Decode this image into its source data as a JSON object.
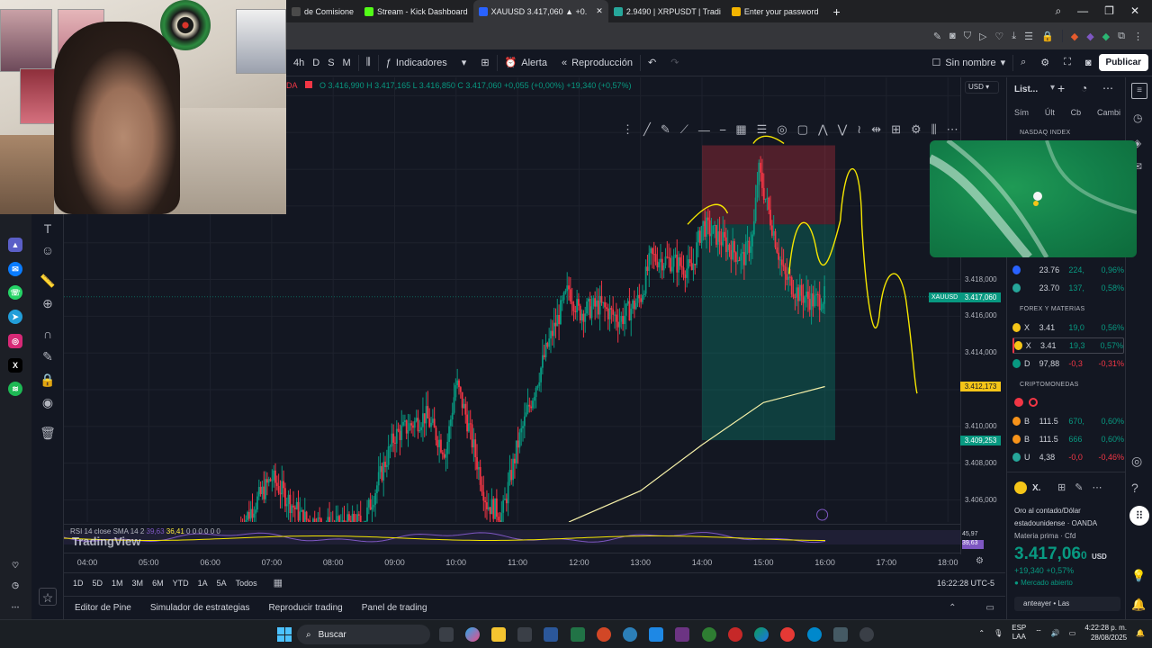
{
  "browser": {
    "tabs": [
      {
        "label": "de Comisione",
        "icon_color": "#4a4a4a"
      },
      {
        "label": "Stream - Kick Dashboard",
        "icon_color": "#53fc18"
      },
      {
        "label": "XAUUSD 3.417,060 ▲ +0.",
        "icon_color": "#2962ff",
        "active": true
      },
      {
        "label": "2.9490 | XRPUSDT | Tradi",
        "icon_color": "#26a69a"
      },
      {
        "label": "Enter your password",
        "icon_color": "#f4b400"
      }
    ],
    "new_tab_icon": "plus-icon"
  },
  "toolbar": {
    "timeframes": [
      "4h",
      "D",
      "S",
      "M"
    ],
    "indicators_label": "Indicadores",
    "alert_label": "Alerta",
    "replay_label": "Reproducción",
    "layout_name": "Sin nombre",
    "publish_label": "Publicar"
  },
  "ohlc": {
    "symbol_fragment": "DA",
    "text": "O 3.416,990 H 3.417,165 L 3.416,850 C 3.417,060 +0,055 (+0,00%) +19,340 (+0,57%)"
  },
  "price_axis": {
    "currency": "USD",
    "labels": [
      {
        "value": "3.418,000",
        "price": 3418.0
      },
      {
        "value": "3.416,000",
        "price": 3416.0
      },
      {
        "value": "3.414,000",
        "price": 3414.0
      },
      {
        "value": "3.410,000",
        "price": 3410.0
      },
      {
        "value": "3.408,000",
        "price": 3408.0
      },
      {
        "value": "3.406,000",
        "price": 3406.0
      }
    ],
    "tags": [
      {
        "text": "3.417,060",
        "price": 3417.06,
        "color": "#089981",
        "prefix": "XAUUSD"
      },
      {
        "text": "3.412,173",
        "price": 3412.173,
        "color": "#f5c518",
        "dark": true
      },
      {
        "text": "3.409,253",
        "price": 3409.253,
        "color": "#089981"
      }
    ]
  },
  "rsi": {
    "label": "RSI 14 close SMA 14 2",
    "v1": "39,63",
    "v2": "36,41",
    "rest": "0 0 0 0 0 0",
    "axis_values": [
      "45,97",
      "39,63"
    ]
  },
  "time_axis": {
    "labels": [
      "04:00",
      "05:00",
      "06:00",
      "07:00",
      "08:00",
      "09:00",
      "10:00",
      "11:00",
      "12:00",
      "13:00",
      "14:00",
      "15:00",
      "16:00",
      "17:00",
      "18:00"
    ]
  },
  "watermark": "TradingView",
  "ranges": [
    "1D",
    "5D",
    "1M",
    "3M",
    "6M",
    "YTD",
    "1A",
    "5A",
    "Todos"
  ],
  "clock": "16:22:28 UTC-5",
  "bottom_panels": [
    "Editor de Pine",
    "Simulador de estrategias",
    "Reproducir trading",
    "Panel de trading"
  ],
  "watchlist": {
    "title": "List...",
    "columns": [
      "Sím",
      "Últ",
      "Cb",
      "Cambi"
    ],
    "nasdaq": "NASDAQ INDEX",
    "sections": [
      "FOREX Y MATERIAS",
      "CRIPTOMONEDAS"
    ],
    "rows_top": [
      {
        "sym": "",
        "last": "23.76",
        "chg": "224,",
        "pct": "0,96%",
        "color": "#2962ff"
      },
      {
        "sym": "",
        "last": "23.70",
        "chg": "137,",
        "pct": "0,58%",
        "color": "#26a69a"
      }
    ],
    "rows_fx": [
      {
        "sym": "X",
        "last": "3.41",
        "chg": "19,0",
        "pct": "0,56%",
        "color": "#f5c518",
        "dir": "up"
      },
      {
        "sym": "X",
        "last": "3.41",
        "chg": "19,3",
        "pct": "0,57%",
        "color": "#f5c518",
        "dir": "up"
      },
      {
        "sym": "D",
        "last": "97,88",
        "chg": "-0,3",
        "pct": "-0,31%",
        "color": "#089981",
        "dir": "down"
      }
    ],
    "rows_crypto": [
      {
        "sym": "B",
        "last": "111.5",
        "chg": "670,",
        "pct": "0,60%",
        "color": "#f7931a",
        "dir": "up"
      },
      {
        "sym": "B",
        "last": "111.5",
        "chg": "666",
        "pct": "0,60%",
        "color": "#f7931a",
        "dir": "up"
      },
      {
        "sym": "U",
        "last": "4,38",
        "chg": "-0,0",
        "pct": "-0,46%",
        "color": "#26a69a",
        "dir": "down"
      }
    ]
  },
  "details": {
    "sym": "X.",
    "name": "Oro al contado/Dólar estadounidense",
    "broker": "OANDA",
    "type": "Materia prima",
    "type2": "Cfd",
    "price": "3.417,06",
    "price_small": "0",
    "currency": "USD",
    "change": "+19,340",
    "change_pct": "+0,57%",
    "status": "Mercado abierto",
    "news": "anteayer • Las"
  },
  "taskbar": {
    "search_placeholder": "Buscar",
    "lang": "ESP",
    "lang2": "LAA",
    "time": "4:22:28 p. m.",
    "date": "28/08/2025"
  },
  "chart_data": {
    "type": "candlestick",
    "x_labels": [
      "04:00",
      "05:00",
      "06:00",
      "07:00",
      "08:00",
      "09:00",
      "10:00",
      "11:00",
      "12:00",
      "13:00",
      "14:00",
      "15:00",
      "16:00",
      "17:00",
      "18:00"
    ],
    "ylim": [
      3404.8,
      3429.0
    ],
    "current_price": 3417.06,
    "price_series": [
      [
        "06:30",
        3404.6
      ],
      [
        "07:00",
        3407.2
      ],
      [
        "07:30",
        3405.0
      ],
      [
        "08:00",
        3404.5
      ],
      [
        "08:30",
        3404.8
      ],
      [
        "09:00",
        3409.5
      ],
      [
        "09:30",
        3410.6
      ],
      [
        "09:50",
        3408.6
      ],
      [
        "10:00",
        3412.4
      ],
      [
        "10:10",
        3410.5
      ],
      [
        "10:30",
        3405.8
      ],
      [
        "10:45",
        3405.2
      ],
      [
        "11:00",
        3409.0
      ],
      [
        "11:30",
        3414.5
      ],
      [
        "11:50",
        3417.5
      ],
      [
        "12:00",
        3416.2
      ],
      [
        "12:20",
        3416.6
      ],
      [
        "12:40",
        3415.8
      ],
      [
        "13:00",
        3417.0
      ],
      [
        "13:10",
        3419.2
      ],
      [
        "13:30",
        3419.0
      ],
      [
        "13:50",
        3418.5
      ],
      [
        "14:00",
        3421.0
      ],
      [
        "14:20",
        3420.1
      ],
      [
        "14:40",
        3419.1
      ],
      [
        "14:50",
        3420.4
      ],
      [
        "14:55",
        3424.0
      ],
      [
        "15:10",
        3420.6
      ],
      [
        "15:20",
        3418.2
      ],
      [
        "15:35",
        3417.2
      ],
      [
        "15:50",
        3416.8
      ],
      [
        "16:00",
        3417.06
      ]
    ],
    "ma_series": [
      [
        "11:50",
        3404.8
      ],
      [
        "13:00",
        3406.5
      ],
      [
        "14:00",
        3409.0
      ],
      [
        "15:00",
        3411.3
      ],
      [
        "16:00",
        3412.173
      ]
    ],
    "position": {
      "entry": 3421.0,
      "stop": 3425.3,
      "target": 3409.253,
      "from": "14:00",
      "to": "16:10"
    }
  }
}
